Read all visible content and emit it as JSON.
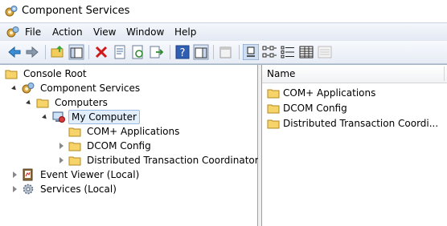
{
  "window": {
    "title": "Component Services"
  },
  "menu": [
    {
      "label": "File"
    },
    {
      "label": "Action"
    },
    {
      "label": "View"
    },
    {
      "label": "Window"
    },
    {
      "label": "Help"
    }
  ],
  "toolbar": {
    "buttons": [
      "back-icon",
      "forward-icon",
      "up-one-level-icon",
      "show-hide-console-tree-icon",
      "delete-icon",
      "properties-icon",
      "refresh-icon",
      "export-list-icon",
      "help-icon",
      "show-hide-action-pane-icon",
      "new-window-icon",
      "large-icons-view-icon",
      "small-icons-view-icon",
      "list-view-icon",
      "detail-view-icon",
      "disabled-view-icon"
    ]
  },
  "tree": {
    "items": [
      {
        "label": "Console Root",
        "icon": "folder-icon"
      },
      {
        "label": "Component Services",
        "icon": "component-services-icon"
      },
      {
        "label": "Computers",
        "icon": "folder-icon"
      },
      {
        "label": "My Computer",
        "icon": "my-computer-icon"
      },
      {
        "label": "COM+ Applications",
        "icon": "folder-icon"
      },
      {
        "label": "DCOM Config",
        "icon": "folder-icon"
      },
      {
        "label": "Distributed Transaction Coordinator",
        "icon": "folder-icon"
      },
      {
        "label": "Event Viewer (Local)",
        "icon": "event-viewer-icon"
      },
      {
        "label": "Services (Local)",
        "icon": "services-gear-icon"
      }
    ]
  },
  "list": {
    "column": "Name",
    "items": [
      {
        "label": "COM+ Applications",
        "icon": "folder-icon"
      },
      {
        "label": "DCOM Config",
        "icon": "folder-icon"
      },
      {
        "label": "Distributed Transaction Coordi...",
        "icon": "folder-icon"
      }
    ]
  }
}
